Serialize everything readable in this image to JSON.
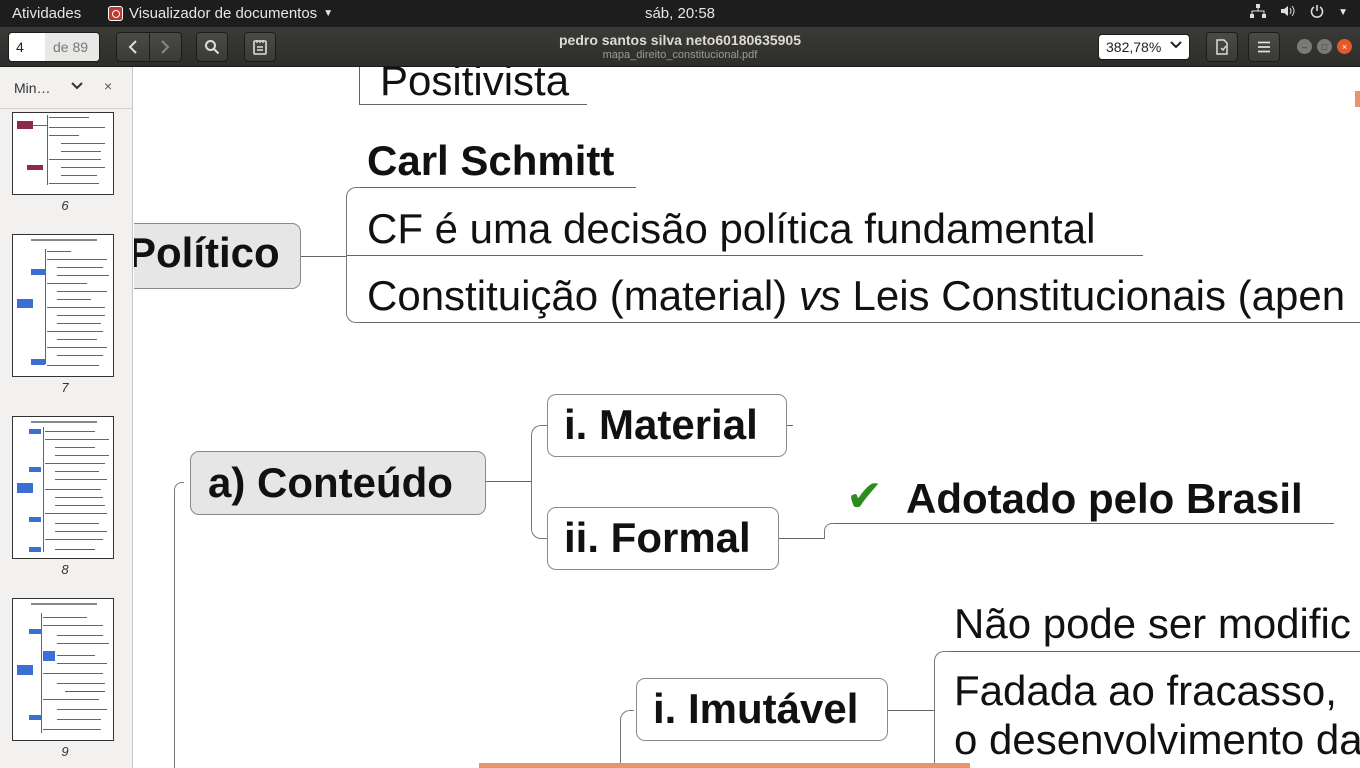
{
  "topbar": {
    "activities": "Atividades",
    "app_name": "Visualizador de documentos",
    "clock": "sáb, 20:58",
    "tray_icons": [
      "network-icon",
      "volume-icon",
      "power-icon"
    ]
  },
  "headerbar": {
    "page_current": "4",
    "page_total": "de 89",
    "title": "pedro santos silva neto60180635905",
    "subtitle": "mapa_direito_constitucional.pdf",
    "zoom": "382,78%"
  },
  "sidebar": {
    "view_selector": "Min…",
    "thumbnails": [
      {
        "label": "6"
      },
      {
        "label": "7"
      },
      {
        "label": "8"
      },
      {
        "label": "9"
      }
    ]
  },
  "document": {
    "positivista": "Positivista",
    "carl_schmitt": "Carl Schmitt",
    "politico": "Político",
    "cf_decisao": "CF é uma decisão política fundamental",
    "constituicao_pre": "Constituição (material) ",
    "constituicao_vs": "vs",
    "constituicao_post": " Leis Constitucionais (apen",
    "conteudo": "a) Conteúdo",
    "material": "i. Material",
    "formal": "ii. Formal",
    "checkmark": "✔",
    "adotado": "Adotado pelo Brasil",
    "nao_pode": "Não pode ser modific",
    "imutavel": "i. Imutável",
    "fadada_1": "Fadada ao fracasso,",
    "fadada_2": "o desenvolvimento da"
  },
  "colors": {
    "accent_orange": "#e8956b",
    "check_green": "#2e8b1f",
    "node_gray": "#e6e6e6"
  }
}
